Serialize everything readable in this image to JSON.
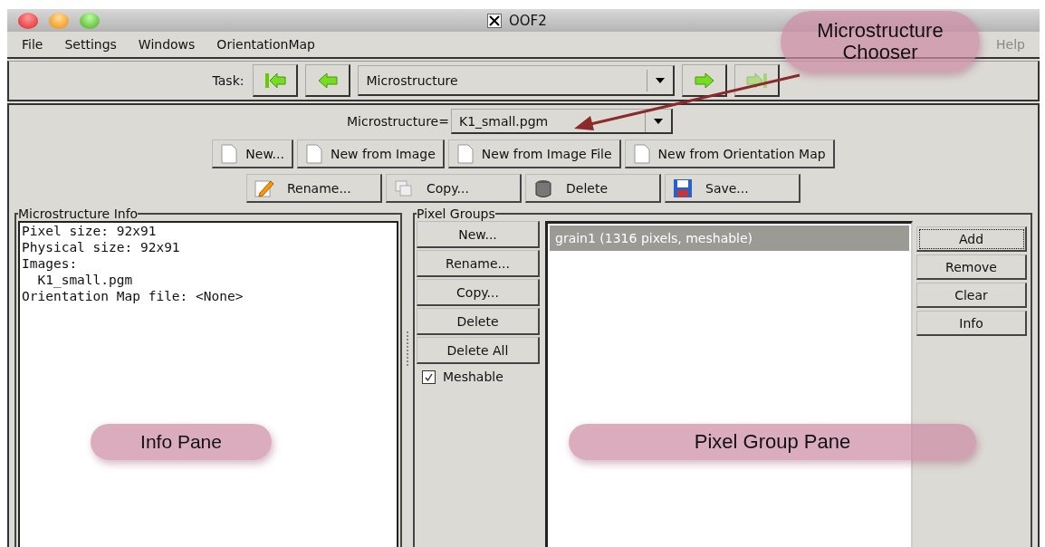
{
  "window": {
    "title": "OOF2"
  },
  "menu": [
    "File",
    "Settings",
    "Windows",
    "OrientationMap"
  ],
  "help_menu": "Help",
  "task": {
    "label": "Task:",
    "value": "Microstructure",
    "nav": [
      {
        "kind": "first",
        "disabled": false
      },
      {
        "kind": "prev",
        "disabled": false
      }
    ],
    "nav_after": [
      {
        "kind": "next",
        "disabled": false
      },
      {
        "kind": "last",
        "disabled": true
      }
    ]
  },
  "chooser": {
    "label": "Microstructure=",
    "value": "K1_small.pgm"
  },
  "create_buttons": [
    {
      "label": "New..."
    },
    {
      "label": "New from Image"
    },
    {
      "label": "New from Image File"
    },
    {
      "label": "New from Orientation Map"
    }
  ],
  "edit_buttons": [
    {
      "label": "Rename...",
      "kind": "rename"
    },
    {
      "label": "Copy...",
      "kind": "copy"
    },
    {
      "label": "Delete",
      "kind": "delete"
    },
    {
      "label": "Save...",
      "kind": "save"
    }
  ],
  "info": {
    "title": "Microstructure Info",
    "lines": [
      "Pixel size: 92x91",
      "Physical size: 92x91",
      "Images:",
      "  K1_small.pgm",
      "Orientation Map file: <None>"
    ]
  },
  "pixel_groups": {
    "title": "Pixel Groups",
    "buttons": [
      "New...",
      "Rename...",
      "Copy...",
      "Delete",
      "Delete All"
    ],
    "meshable": {
      "label": "Meshable",
      "checked": true
    },
    "items": [
      {
        "label": "grain1 (1316 pixels, meshable)",
        "selected": true
      }
    ],
    "actions": [
      {
        "label": "Add",
        "focused": true
      },
      {
        "label": "Remove",
        "focused": false
      },
      {
        "label": "Clear",
        "focused": false
      },
      {
        "label": "Info",
        "focused": false
      }
    ]
  },
  "annotations": [
    {
      "text": "Microstructure Chooser",
      "kind": "top"
    },
    {
      "text": "Info Pane",
      "kind": "info"
    },
    {
      "text": "Pixel Group Pane",
      "kind": "groups"
    }
  ]
}
